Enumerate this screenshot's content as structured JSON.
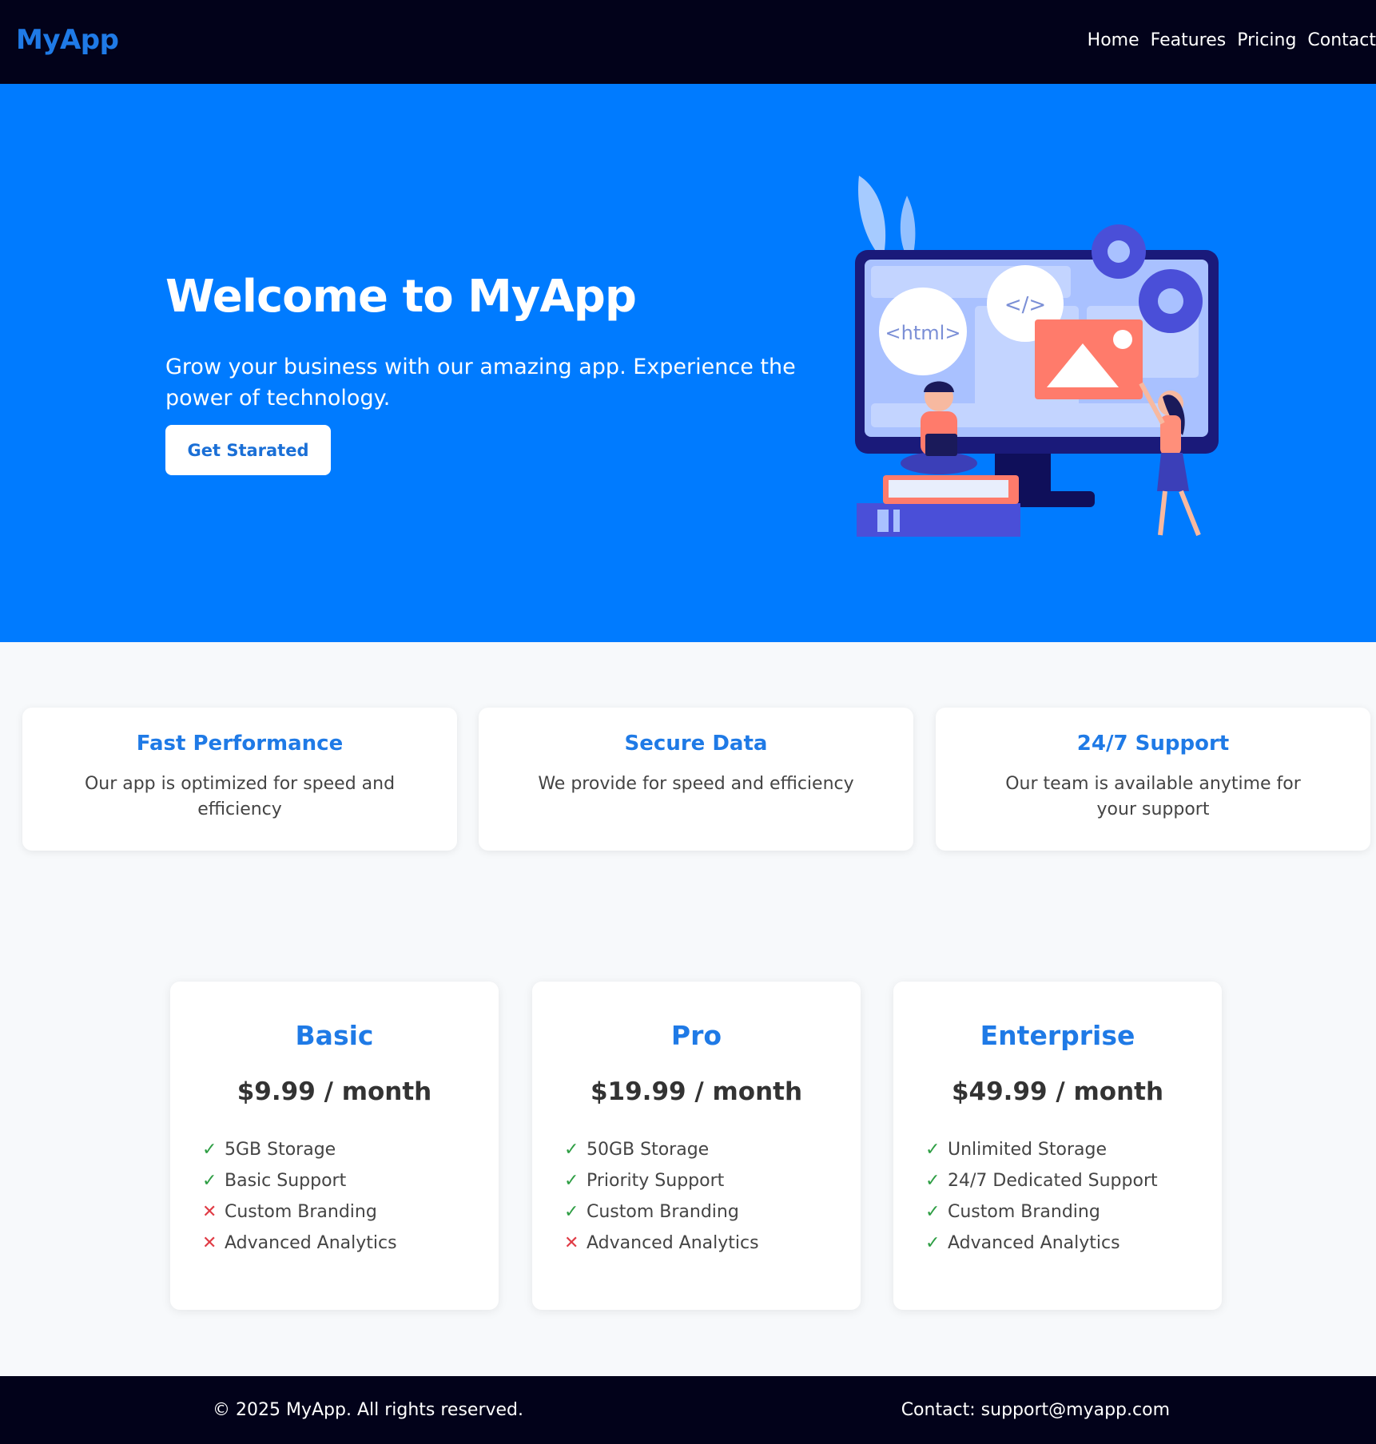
{
  "nav": {
    "brand": "MyApp",
    "links": [
      "Home",
      "Features",
      "Pricing",
      "Contact"
    ]
  },
  "hero": {
    "title": "Welcome to MyApp",
    "subtitle": "Grow your business with our amazing app. Experience the power of technology.",
    "button_label": "Get Starated",
    "illustration_labels": {
      "html": "<html>",
      "code": "</>"
    }
  },
  "features": [
    {
      "title": "Fast Performance",
      "text": "Our app is optimized for speed and efficiency"
    },
    {
      "title": "Secure Data",
      "text": "We provide for speed and efficiency"
    },
    {
      "title": "24/7 Support",
      "text": "Our team is available anytime for your support"
    }
  ],
  "pricing": [
    {
      "name": "Basic",
      "price": "$9.99 / month",
      "features": [
        {
          "label": "5GB Storage",
          "included": true
        },
        {
          "label": "Basic Support",
          "included": true
        },
        {
          "label": "Custom Branding",
          "included": false
        },
        {
          "label": "Advanced Analytics",
          "included": false
        }
      ]
    },
    {
      "name": "Pro",
      "price": "$19.99 / month",
      "features": [
        {
          "label": "50GB Storage",
          "included": true
        },
        {
          "label": "Priority Support",
          "included": true
        },
        {
          "label": "Custom Branding",
          "included": true
        },
        {
          "label": "Advanced Analytics",
          "included": false
        }
      ]
    },
    {
      "name": "Enterprise",
      "price": "$49.99 / month",
      "features": [
        {
          "label": "Unlimited Storage",
          "included": true
        },
        {
          "label": "24/7 Dedicated Support",
          "included": true
        },
        {
          "label": "Custom Branding",
          "included": true
        },
        {
          "label": "Advanced Analytics",
          "included": true
        }
      ]
    }
  ],
  "marks": {
    "yes": "✓",
    "no": "✕"
  },
  "footer": {
    "copyright": "© 2025 MyApp. All rights reserved.",
    "contact": "Contact: support@myapp.com"
  },
  "colors": {
    "nav_bg": "#02021a",
    "hero_bg": "#007bff",
    "accent": "#1f7ae6",
    "check": "#2e9e44",
    "cross": "#e03b45"
  }
}
